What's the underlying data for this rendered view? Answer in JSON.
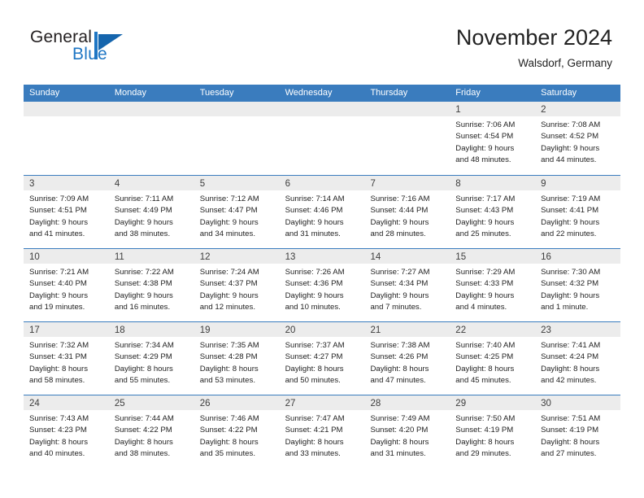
{
  "brand": {
    "name_part1": "General",
    "name_part2": "Blue",
    "mark_icon": "blue-triangle-flag-icon"
  },
  "header": {
    "month_title": "November 2024",
    "location": "Walsdorf, Germany"
  },
  "colors": {
    "header_blue": "#3a7cbe",
    "brand_blue": "#1e76c4",
    "day_strip_gray": "#ececec",
    "text": "#232323"
  },
  "calendar": {
    "weekdays": [
      "Sunday",
      "Monday",
      "Tuesday",
      "Wednesday",
      "Thursday",
      "Friday",
      "Saturday"
    ],
    "weeks": [
      [
        {
          "day": "",
          "empty": true,
          "lines": []
        },
        {
          "day": "",
          "empty": true,
          "lines": []
        },
        {
          "day": "",
          "empty": true,
          "lines": []
        },
        {
          "day": "",
          "empty": true,
          "lines": []
        },
        {
          "day": "",
          "empty": true,
          "lines": []
        },
        {
          "day": "1",
          "empty": false,
          "lines": [
            "Sunrise: 7:06 AM",
            "Sunset: 4:54 PM",
            "Daylight: 9 hours",
            "and 48 minutes."
          ]
        },
        {
          "day": "2",
          "empty": false,
          "lines": [
            "Sunrise: 7:08 AM",
            "Sunset: 4:52 PM",
            "Daylight: 9 hours",
            "and 44 minutes."
          ]
        }
      ],
      [
        {
          "day": "3",
          "empty": false,
          "lines": [
            "Sunrise: 7:09 AM",
            "Sunset: 4:51 PM",
            "Daylight: 9 hours",
            "and 41 minutes."
          ]
        },
        {
          "day": "4",
          "empty": false,
          "lines": [
            "Sunrise: 7:11 AM",
            "Sunset: 4:49 PM",
            "Daylight: 9 hours",
            "and 38 minutes."
          ]
        },
        {
          "day": "5",
          "empty": false,
          "lines": [
            "Sunrise: 7:12 AM",
            "Sunset: 4:47 PM",
            "Daylight: 9 hours",
            "and 34 minutes."
          ]
        },
        {
          "day": "6",
          "empty": false,
          "lines": [
            "Sunrise: 7:14 AM",
            "Sunset: 4:46 PM",
            "Daylight: 9 hours",
            "and 31 minutes."
          ]
        },
        {
          "day": "7",
          "empty": false,
          "lines": [
            "Sunrise: 7:16 AM",
            "Sunset: 4:44 PM",
            "Daylight: 9 hours",
            "and 28 minutes."
          ]
        },
        {
          "day": "8",
          "empty": false,
          "lines": [
            "Sunrise: 7:17 AM",
            "Sunset: 4:43 PM",
            "Daylight: 9 hours",
            "and 25 minutes."
          ]
        },
        {
          "day": "9",
          "empty": false,
          "lines": [
            "Sunrise: 7:19 AM",
            "Sunset: 4:41 PM",
            "Daylight: 9 hours",
            "and 22 minutes."
          ]
        }
      ],
      [
        {
          "day": "10",
          "empty": false,
          "lines": [
            "Sunrise: 7:21 AM",
            "Sunset: 4:40 PM",
            "Daylight: 9 hours",
            "and 19 minutes."
          ]
        },
        {
          "day": "11",
          "empty": false,
          "lines": [
            "Sunrise: 7:22 AM",
            "Sunset: 4:38 PM",
            "Daylight: 9 hours",
            "and 16 minutes."
          ]
        },
        {
          "day": "12",
          "empty": false,
          "lines": [
            "Sunrise: 7:24 AM",
            "Sunset: 4:37 PM",
            "Daylight: 9 hours",
            "and 12 minutes."
          ]
        },
        {
          "day": "13",
          "empty": false,
          "lines": [
            "Sunrise: 7:26 AM",
            "Sunset: 4:36 PM",
            "Daylight: 9 hours",
            "and 10 minutes."
          ]
        },
        {
          "day": "14",
          "empty": false,
          "lines": [
            "Sunrise: 7:27 AM",
            "Sunset: 4:34 PM",
            "Daylight: 9 hours",
            "and 7 minutes."
          ]
        },
        {
          "day": "15",
          "empty": false,
          "lines": [
            "Sunrise: 7:29 AM",
            "Sunset: 4:33 PM",
            "Daylight: 9 hours",
            "and 4 minutes."
          ]
        },
        {
          "day": "16",
          "empty": false,
          "lines": [
            "Sunrise: 7:30 AM",
            "Sunset: 4:32 PM",
            "Daylight: 9 hours",
            "and 1 minute."
          ]
        }
      ],
      [
        {
          "day": "17",
          "empty": false,
          "lines": [
            "Sunrise: 7:32 AM",
            "Sunset: 4:31 PM",
            "Daylight: 8 hours",
            "and 58 minutes."
          ]
        },
        {
          "day": "18",
          "empty": false,
          "lines": [
            "Sunrise: 7:34 AM",
            "Sunset: 4:29 PM",
            "Daylight: 8 hours",
            "and 55 minutes."
          ]
        },
        {
          "day": "19",
          "empty": false,
          "lines": [
            "Sunrise: 7:35 AM",
            "Sunset: 4:28 PM",
            "Daylight: 8 hours",
            "and 53 minutes."
          ]
        },
        {
          "day": "20",
          "empty": false,
          "lines": [
            "Sunrise: 7:37 AM",
            "Sunset: 4:27 PM",
            "Daylight: 8 hours",
            "and 50 minutes."
          ]
        },
        {
          "day": "21",
          "empty": false,
          "lines": [
            "Sunrise: 7:38 AM",
            "Sunset: 4:26 PM",
            "Daylight: 8 hours",
            "and 47 minutes."
          ]
        },
        {
          "day": "22",
          "empty": false,
          "lines": [
            "Sunrise: 7:40 AM",
            "Sunset: 4:25 PM",
            "Daylight: 8 hours",
            "and 45 minutes."
          ]
        },
        {
          "day": "23",
          "empty": false,
          "lines": [
            "Sunrise: 7:41 AM",
            "Sunset: 4:24 PM",
            "Daylight: 8 hours",
            "and 42 minutes."
          ]
        }
      ],
      [
        {
          "day": "24",
          "empty": false,
          "lines": [
            "Sunrise: 7:43 AM",
            "Sunset: 4:23 PM",
            "Daylight: 8 hours",
            "and 40 minutes."
          ]
        },
        {
          "day": "25",
          "empty": false,
          "lines": [
            "Sunrise: 7:44 AM",
            "Sunset: 4:22 PM",
            "Daylight: 8 hours",
            "and 38 minutes."
          ]
        },
        {
          "day": "26",
          "empty": false,
          "lines": [
            "Sunrise: 7:46 AM",
            "Sunset: 4:22 PM",
            "Daylight: 8 hours",
            "and 35 minutes."
          ]
        },
        {
          "day": "27",
          "empty": false,
          "lines": [
            "Sunrise: 7:47 AM",
            "Sunset: 4:21 PM",
            "Daylight: 8 hours",
            "and 33 minutes."
          ]
        },
        {
          "day": "28",
          "empty": false,
          "lines": [
            "Sunrise: 7:49 AM",
            "Sunset: 4:20 PM",
            "Daylight: 8 hours",
            "and 31 minutes."
          ]
        },
        {
          "day": "29",
          "empty": false,
          "lines": [
            "Sunrise: 7:50 AM",
            "Sunset: 4:19 PM",
            "Daylight: 8 hours",
            "and 29 minutes."
          ]
        },
        {
          "day": "30",
          "empty": false,
          "lines": [
            "Sunrise: 7:51 AM",
            "Sunset: 4:19 PM",
            "Daylight: 8 hours",
            "and 27 minutes."
          ]
        }
      ]
    ]
  }
}
